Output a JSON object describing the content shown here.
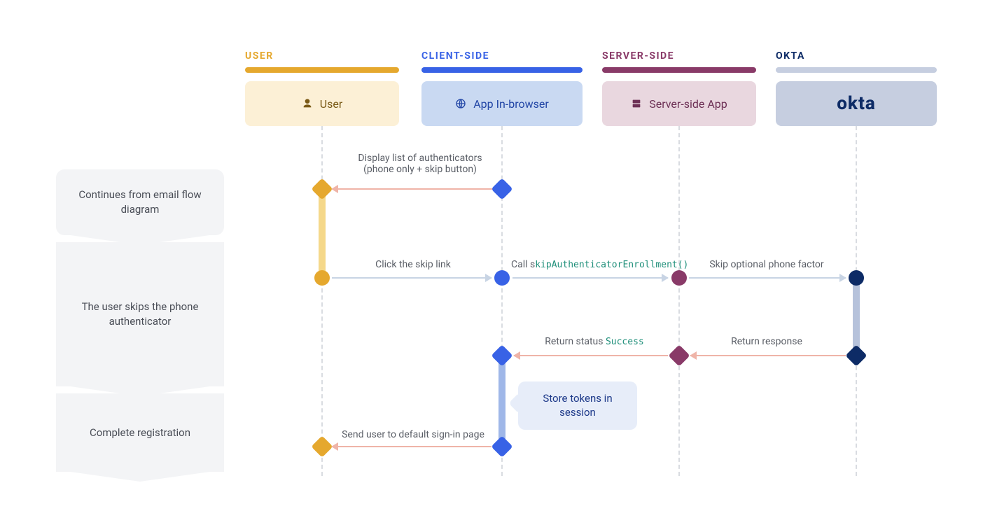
{
  "steps": {
    "s1": "Continues from email flow diagram",
    "s2": "The user skips the phone authenticator",
    "s3": "Complete registration"
  },
  "lanes": {
    "user": {
      "title": "USER",
      "label": "User"
    },
    "client": {
      "title": "CLIENT-SIDE",
      "label": "App In-browser"
    },
    "server": {
      "title": "SERVER-SIDE",
      "label": "Server-side App"
    },
    "okta": {
      "title": "OKTA",
      "label": "okta"
    }
  },
  "messages": {
    "m1a": "Display list of authenticators",
    "m1b": "(phone only + skip button)",
    "m2": "Click the skip link",
    "m3a": "Call s",
    "m3b": "kipAuthenticatorEnrollment()",
    "m4": "Skip optional phone factor",
    "m5": "Return response",
    "m6a": "Return status ",
    "m6b": "Success",
    "m7": "Send user to default sign-in page",
    "note": "Store tokens in session"
  }
}
